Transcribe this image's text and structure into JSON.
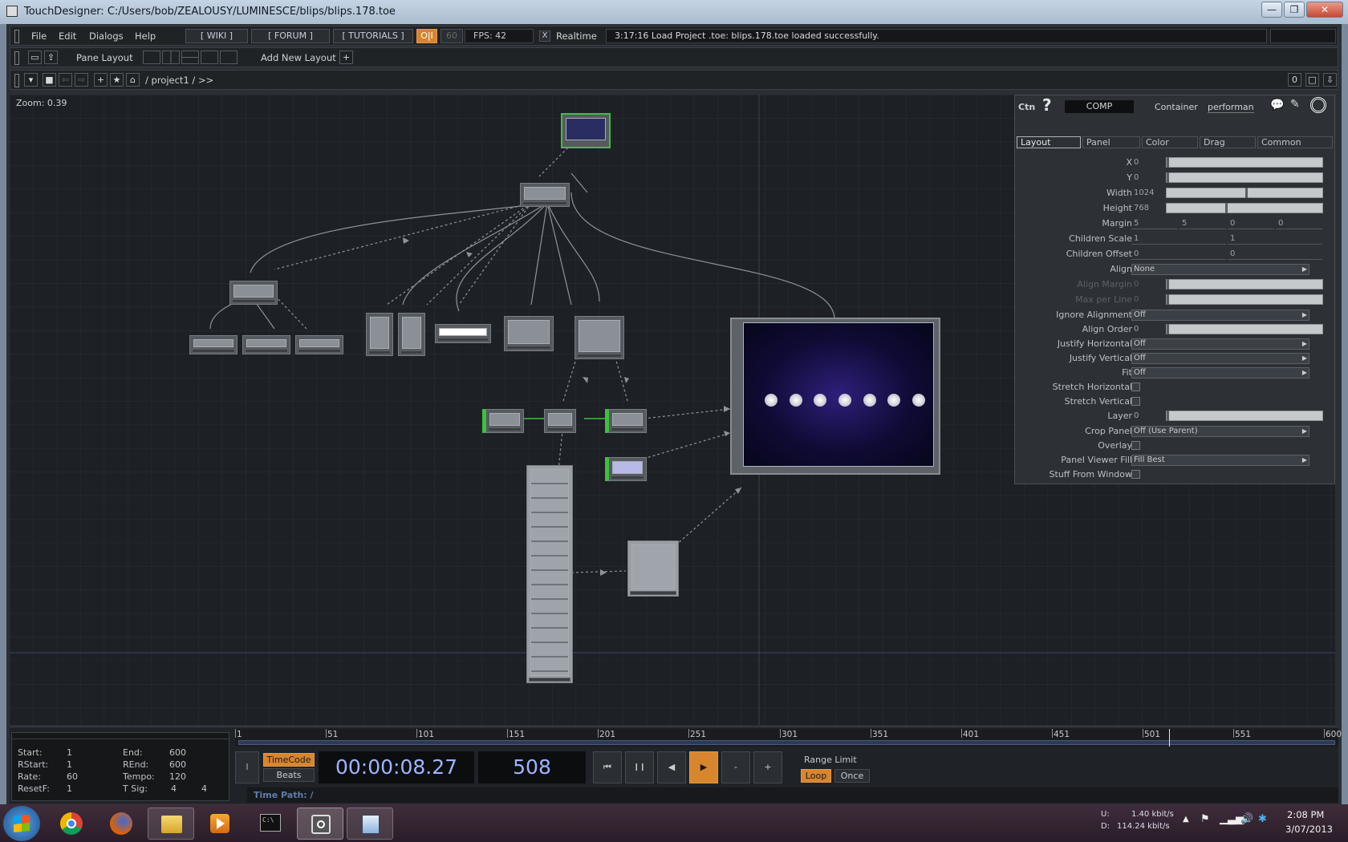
{
  "window": {
    "title": "TouchDesigner: C:/Users/bob/ZEALOUSY/LUMINESCE/blips/blips.178.toe",
    "controls": [
      "—",
      "❐",
      "✕"
    ]
  },
  "menubar": {
    "items": [
      "File",
      "Edit",
      "Dialogs",
      "Help"
    ],
    "links": [
      "[ WIKI ]",
      "[ FORUM ]",
      "[ TUTORIALS ]"
    ],
    "oi": "O|I",
    "fps_cap": "60",
    "fps_text": "FPS: 42",
    "realtime_check": "X",
    "realtime_label": "Realtime",
    "status": "3:17:16 Load Project .toe: blips.178.toe loaded successfully."
  },
  "layoutbar": {
    "pane_layout": "Pane Layout",
    "add_layout": "Add New Layout",
    "plus": "+"
  },
  "pathbar": {
    "path": "/  project1  /  >>",
    "right_buttons": [
      "0",
      "□",
      "⇩"
    ]
  },
  "network": {
    "zoom": "Zoom: 0.39",
    "accent": "#3fbf3f"
  },
  "params": {
    "op_family": "Ctn",
    "help": "?",
    "op_type": "COMP",
    "op_label": "Container",
    "op_name": "performan",
    "tabs": [
      "Layout",
      "Panel",
      "Color",
      "Drag",
      "Common"
    ],
    "x_label": "X",
    "x": "0",
    "y_label": "Y",
    "y": "0",
    "w_label": "Width",
    "w": "1024",
    "h_label": "Height",
    "h": "768",
    "margin_label": "Margin",
    "margin": [
      "5",
      "5",
      "0",
      "0"
    ],
    "cscale_label": "Children Scale",
    "cscale": [
      "1",
      "1"
    ],
    "coffset_label": "Children Offset",
    "coffset": [
      "0",
      "0"
    ],
    "align_label": "Align",
    "align": "None",
    "alignmargin_label": "Align Margin",
    "alignmargin": "0",
    "maxperline_label": "Max per Line",
    "maxperline": "0",
    "ignore_label": "Ignore Alignment",
    "ignore": "Off",
    "alignorder_label": "Align Order",
    "alignorder": "0",
    "jh_label": "Justify Horizontal",
    "jh": "Off",
    "jv_label": "Justify Vertical",
    "jv": "Off",
    "fit_label": "Fit",
    "fit": "Off",
    "sh_label": "Stretch Horizontal",
    "sv_label": "Stretch Vertical",
    "layer_label": "Layer",
    "layer": "0",
    "crop_label": "Crop Panel",
    "crop": "Off (Use Parent)",
    "overlay_label": "Overlay",
    "pvf_label": "Panel Viewer Fill",
    "pvf": "Fill Best",
    "sfw_label": "Stuff From Window"
  },
  "timeline": {
    "start_label": "Start:",
    "start": "1",
    "end_label": "End:",
    "end": "600",
    "rstart_label": "RStart:",
    "rstart": "1",
    "rend_label": "REnd:",
    "rend": "600",
    "rate_label": "Rate:",
    "rate": "60",
    "tempo_label": "Tempo:",
    "tempo": "120",
    "resetf_label": "ResetF:",
    "resetf": "1",
    "tsig_label": "T Sig:",
    "tsig": [
      "4",
      "4"
    ],
    "ticks": [
      "1",
      "51",
      "101",
      "151",
      "201",
      "251",
      "301",
      "351",
      "401",
      "451",
      "501",
      "551",
      "600"
    ],
    "timecode_btn": "TimeCode",
    "beats_btn": "Beats",
    "timecode": "00:00:08.27",
    "frame": "508",
    "range_limit": "Range Limit",
    "loop": "Loop",
    "once": "Once",
    "time_path": "Time Path: /",
    "transport": [
      "⏮",
      "❙❙",
      "◀",
      "▶",
      "-",
      "+"
    ],
    "side_btn": "I"
  },
  "taskbar": {
    "net_up_label": "U:",
    "net_up": "1.40 kbit/s",
    "net_down_label": "D:",
    "net_down": "114.24 kbit/s",
    "time": "2:08 PM",
    "date": "3/07/2013",
    "apps": [
      "windows-start",
      "chrome",
      "firefox",
      "explorer",
      "media-player",
      "cmd",
      "touchdesigner",
      "paint"
    ]
  }
}
